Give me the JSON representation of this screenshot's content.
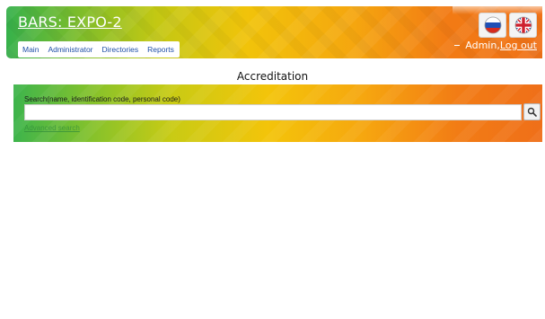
{
  "header": {
    "app_title": "BARS: EXPO-2",
    "nav": [
      "Main",
      "Administrator",
      "Directories",
      "Reports"
    ],
    "languages": [
      {
        "code": "ru",
        "icon": "russia-flag-icon"
      },
      {
        "code": "en",
        "icon": "uk-flag-icon"
      }
    ],
    "user_name": "Admin,",
    "logout_label": "Log out"
  },
  "main": {
    "heading": "Accreditation",
    "search": {
      "label": "Search(name, identification code, personal code)",
      "value": "",
      "placeholder": "",
      "button_icon": "search-icon",
      "extended_link": "Advanced search"
    }
  },
  "colors": {
    "gradient_green": "#36b14b",
    "gradient_yellow": "#f1c30a",
    "gradient_orange": "#f07218",
    "link_blue": "#1e4fa8"
  }
}
